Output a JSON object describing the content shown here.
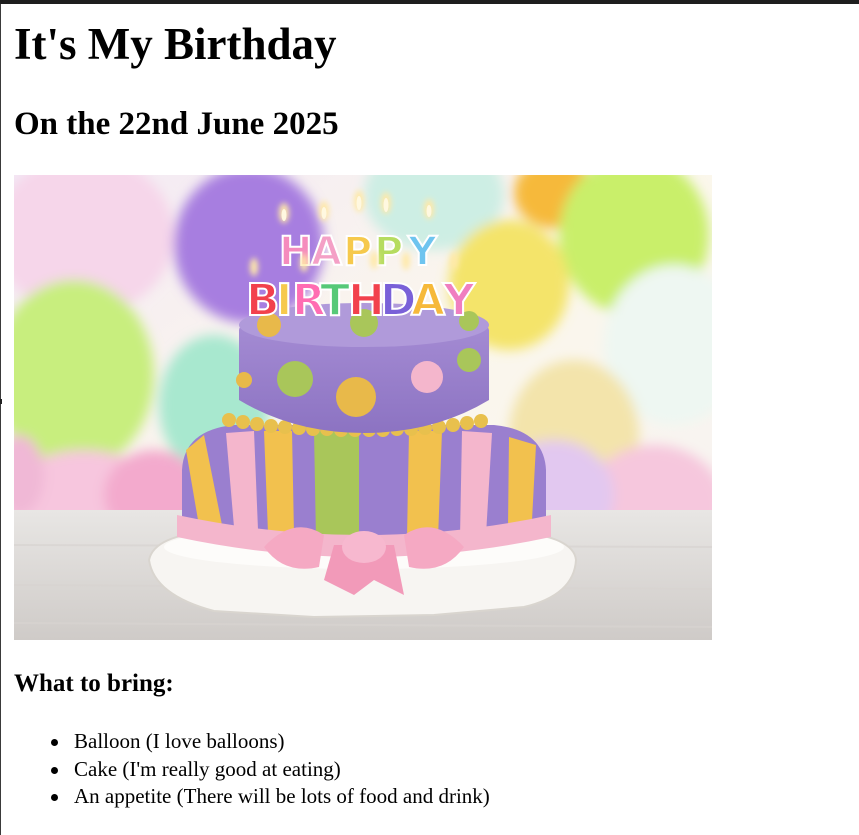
{
  "page": {
    "title": "It's My Birthday",
    "subtitle": "On the 22nd June 2025"
  },
  "image": {
    "alt": "birthday cake",
    "cake_topper_line1": "HAPPY",
    "cake_topper_line2": "BIRTHDAY"
  },
  "bring": {
    "heading": "What to bring:",
    "items": [
      "Balloon (I love balloons)",
      "Cake (I'm really good at eating)",
      "An appetite (There will be lots of food and drink)"
    ]
  },
  "colors": {
    "text": "#000000",
    "background": "#ffffff",
    "cake_purple": "#9a7fcf",
    "cake_pink": "#f4b6cc",
    "cake_yellow": "#f2c14e",
    "cake_green": "#a9c65a"
  }
}
